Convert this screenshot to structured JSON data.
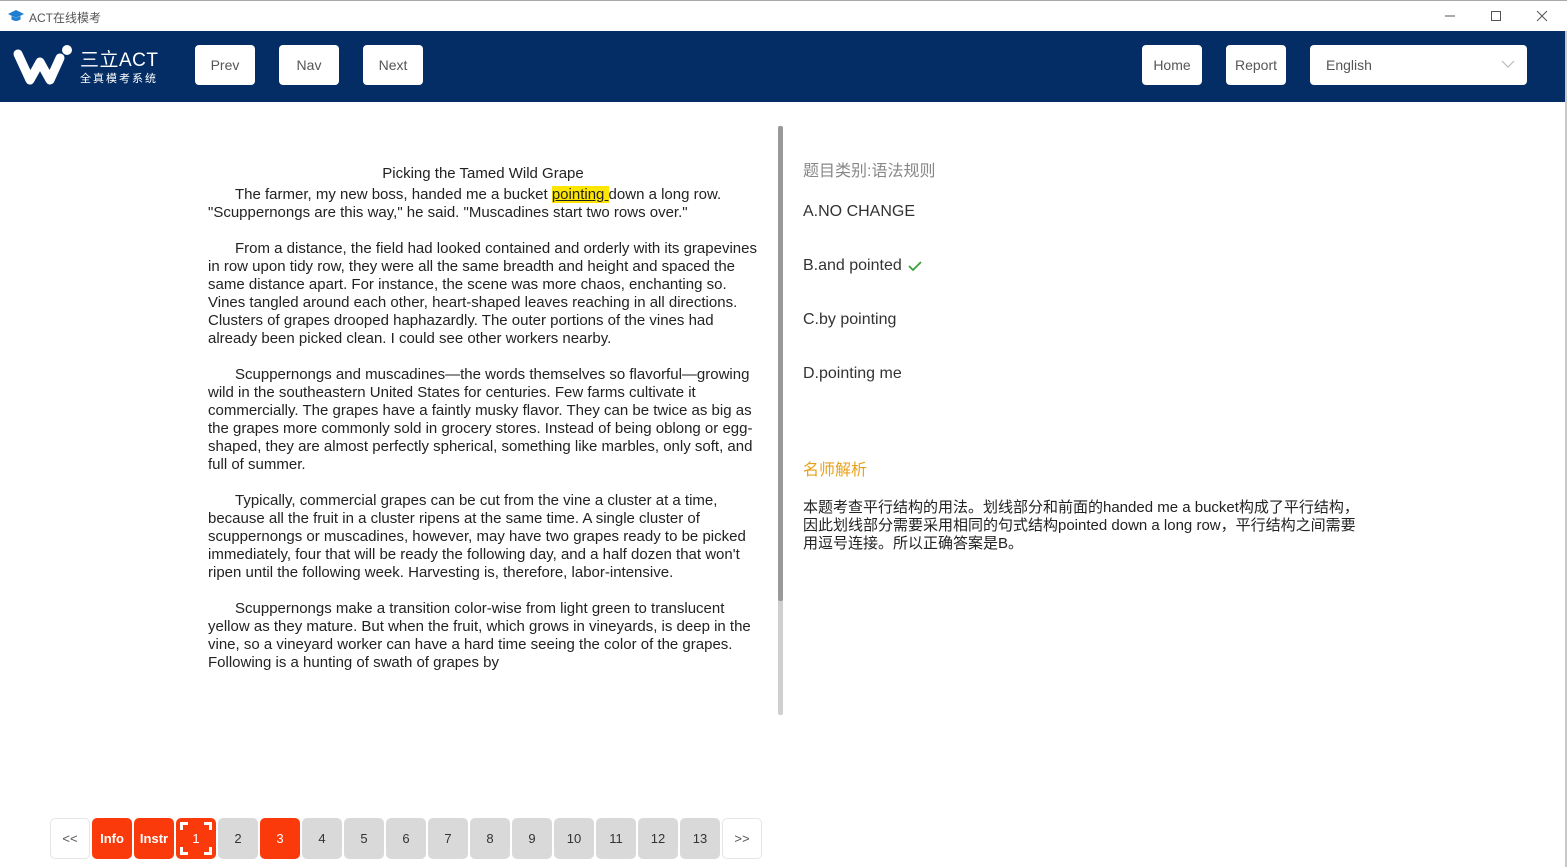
{
  "window": {
    "title": "ACT在线模考",
    "icon": "graduation-cap-icon",
    "controls": [
      "minimize-icon",
      "maximize-icon",
      "close-icon"
    ]
  },
  "header": {
    "logo_line1": "三立ACT",
    "logo_line2": "全真模考系统",
    "prev_label": "Prev",
    "nav_label": "Nav",
    "next_label": "Next",
    "home_label": "Home",
    "report_label": "Report",
    "language_selected": "English",
    "background_color": "#032d64"
  },
  "passage": {
    "title": "Picking the Tamed Wild Grape",
    "p1_before": "The farmer, my new boss, handed me a bucket ",
    "p1_highlight": "pointing ",
    "p1_after": "down a long row. \"Scuppernongs are this way,\" he said. \"Muscadines start two rows over.\"",
    "p2": "From a distance, the field had looked contained and orderly with its grapevines in row upon tidy row, they were all the same breadth and height and spaced the same distance apart. For instance, the scene was more chaos, enchanting so. Vines tangled around each other, heart-shaped leaves reaching in all directions. Clusters of grapes drooped haphazardly. The outer portions of the vines had already been picked clean. I could see other workers nearby.",
    "p3": "Scuppernongs and muscadines—the words themselves so flavorful—growing wild in the southeastern United States for centuries. Few farms cultivate it commercially. The grapes have a faintly musky flavor. They can be twice as big as the grapes more commonly sold in grocery stores. Instead of being oblong or egg-shaped, they are almost perfectly spherical, something like marbles, only soft, and full of summer.",
    "p4": "Typically, commercial grapes can be cut from the vine a cluster at a time, because all the fruit in a cluster ripens at the same time. A single cluster of scuppernongs or muscadines, however, may have two grapes ready to be picked immediately, four that will be ready the following day, and a half dozen that won't ripen until the following week. Harvesting is, therefore, labor-intensive.",
    "p5": "Scuppernongs make a transition color-wise from light green to translucent yellow as they mature. But when the fruit, which grows in vineyards, is deep in the vine, so a vineyard worker can have a hard time seeing the color of the grapes. Following is a hunting of swath of grapes by"
  },
  "question": {
    "category": "题目类别:语法规则",
    "options": [
      {
        "label": "A.NO CHANGE",
        "correct": false
      },
      {
        "label": "B.and pointed",
        "correct": true
      },
      {
        "label": "C.by pointing",
        "correct": false
      },
      {
        "label": "D.pointing me",
        "correct": false
      }
    ],
    "analysis_title": "名师解析",
    "analysis_body": "本题考查平行结构的用法。划线部分和前面的handed me a bucket构成了平行结构，因此划线部分需要采用相同的句式结构pointed down a long row，平行结构之间需要用逗号连接。所以正确答案是B。",
    "correct_color": "#3aa03a",
    "analysis_color": "#e8a21a"
  },
  "pager": {
    "first_label": "<<",
    "last_label": ">>",
    "items": [
      {
        "label": "Info",
        "state": "red"
      },
      {
        "label": "Instr",
        "state": "red"
      },
      {
        "label": "1",
        "state": "current"
      },
      {
        "label": "2",
        "state": "default"
      },
      {
        "label": "3",
        "state": "red"
      },
      {
        "label": "4",
        "state": "default"
      },
      {
        "label": "5",
        "state": "default"
      },
      {
        "label": "6",
        "state": "default"
      },
      {
        "label": "7",
        "state": "default"
      },
      {
        "label": "8",
        "state": "default"
      },
      {
        "label": "9",
        "state": "default"
      },
      {
        "label": "10",
        "state": "default"
      },
      {
        "label": "11",
        "state": "default"
      },
      {
        "label": "12",
        "state": "default"
      },
      {
        "label": "13",
        "state": "default"
      }
    ],
    "red_color": "#fa3a0a"
  }
}
